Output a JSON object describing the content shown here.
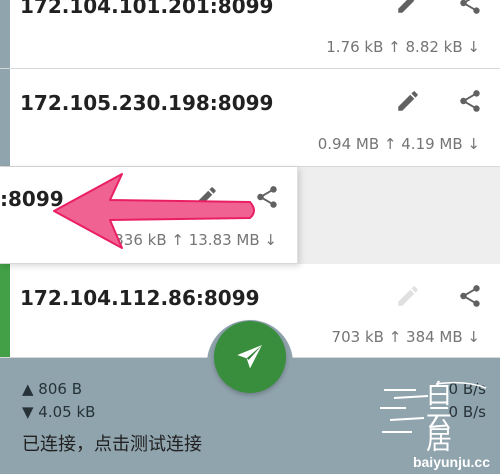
{
  "servers": [
    {
      "address": "172.104.101.201:8099",
      "traffic": "1.76 kB ↑  8.82 kB ↓",
      "stripe": "#90a4ae",
      "edit_enabled": true
    },
    {
      "address": "172.105.230.198:8099",
      "traffic": "0.94 MB ↑  4.19 MB ↓",
      "stripe": "#90a4ae",
      "edit_enabled": true
    },
    {
      "address": ":8099",
      "traffic": "336 kB ↑ 13.83 MB ↓",
      "stripe": "none",
      "edit_enabled": true
    },
    {
      "address": "172.104.112.86:8099",
      "traffic": "703 kB ↑  384 MB ↓",
      "stripe": "#43a047",
      "edit_enabled": false
    }
  ],
  "status": {
    "upload": "▲ 806 B",
    "download": "▼ 4.05 kB",
    "message": "已连接，点击测试连接",
    "upload_speed": "0 B/s",
    "download_speed": "0 B/s"
  },
  "watermark": {
    "glyph_top": "白",
    "glyph_mid": "云",
    "glyph_bottom": "居",
    "url": "baiyunju.cc"
  },
  "colors": {
    "fab": "#388e3c",
    "panel": "#90a4ae",
    "arrow": "#f06292",
    "icon": "#616161",
    "icon_disabled": "#e0e0e0"
  },
  "icons": [
    "edit-icon",
    "share-icon",
    "send-icon",
    "arrow-annotation"
  ]
}
